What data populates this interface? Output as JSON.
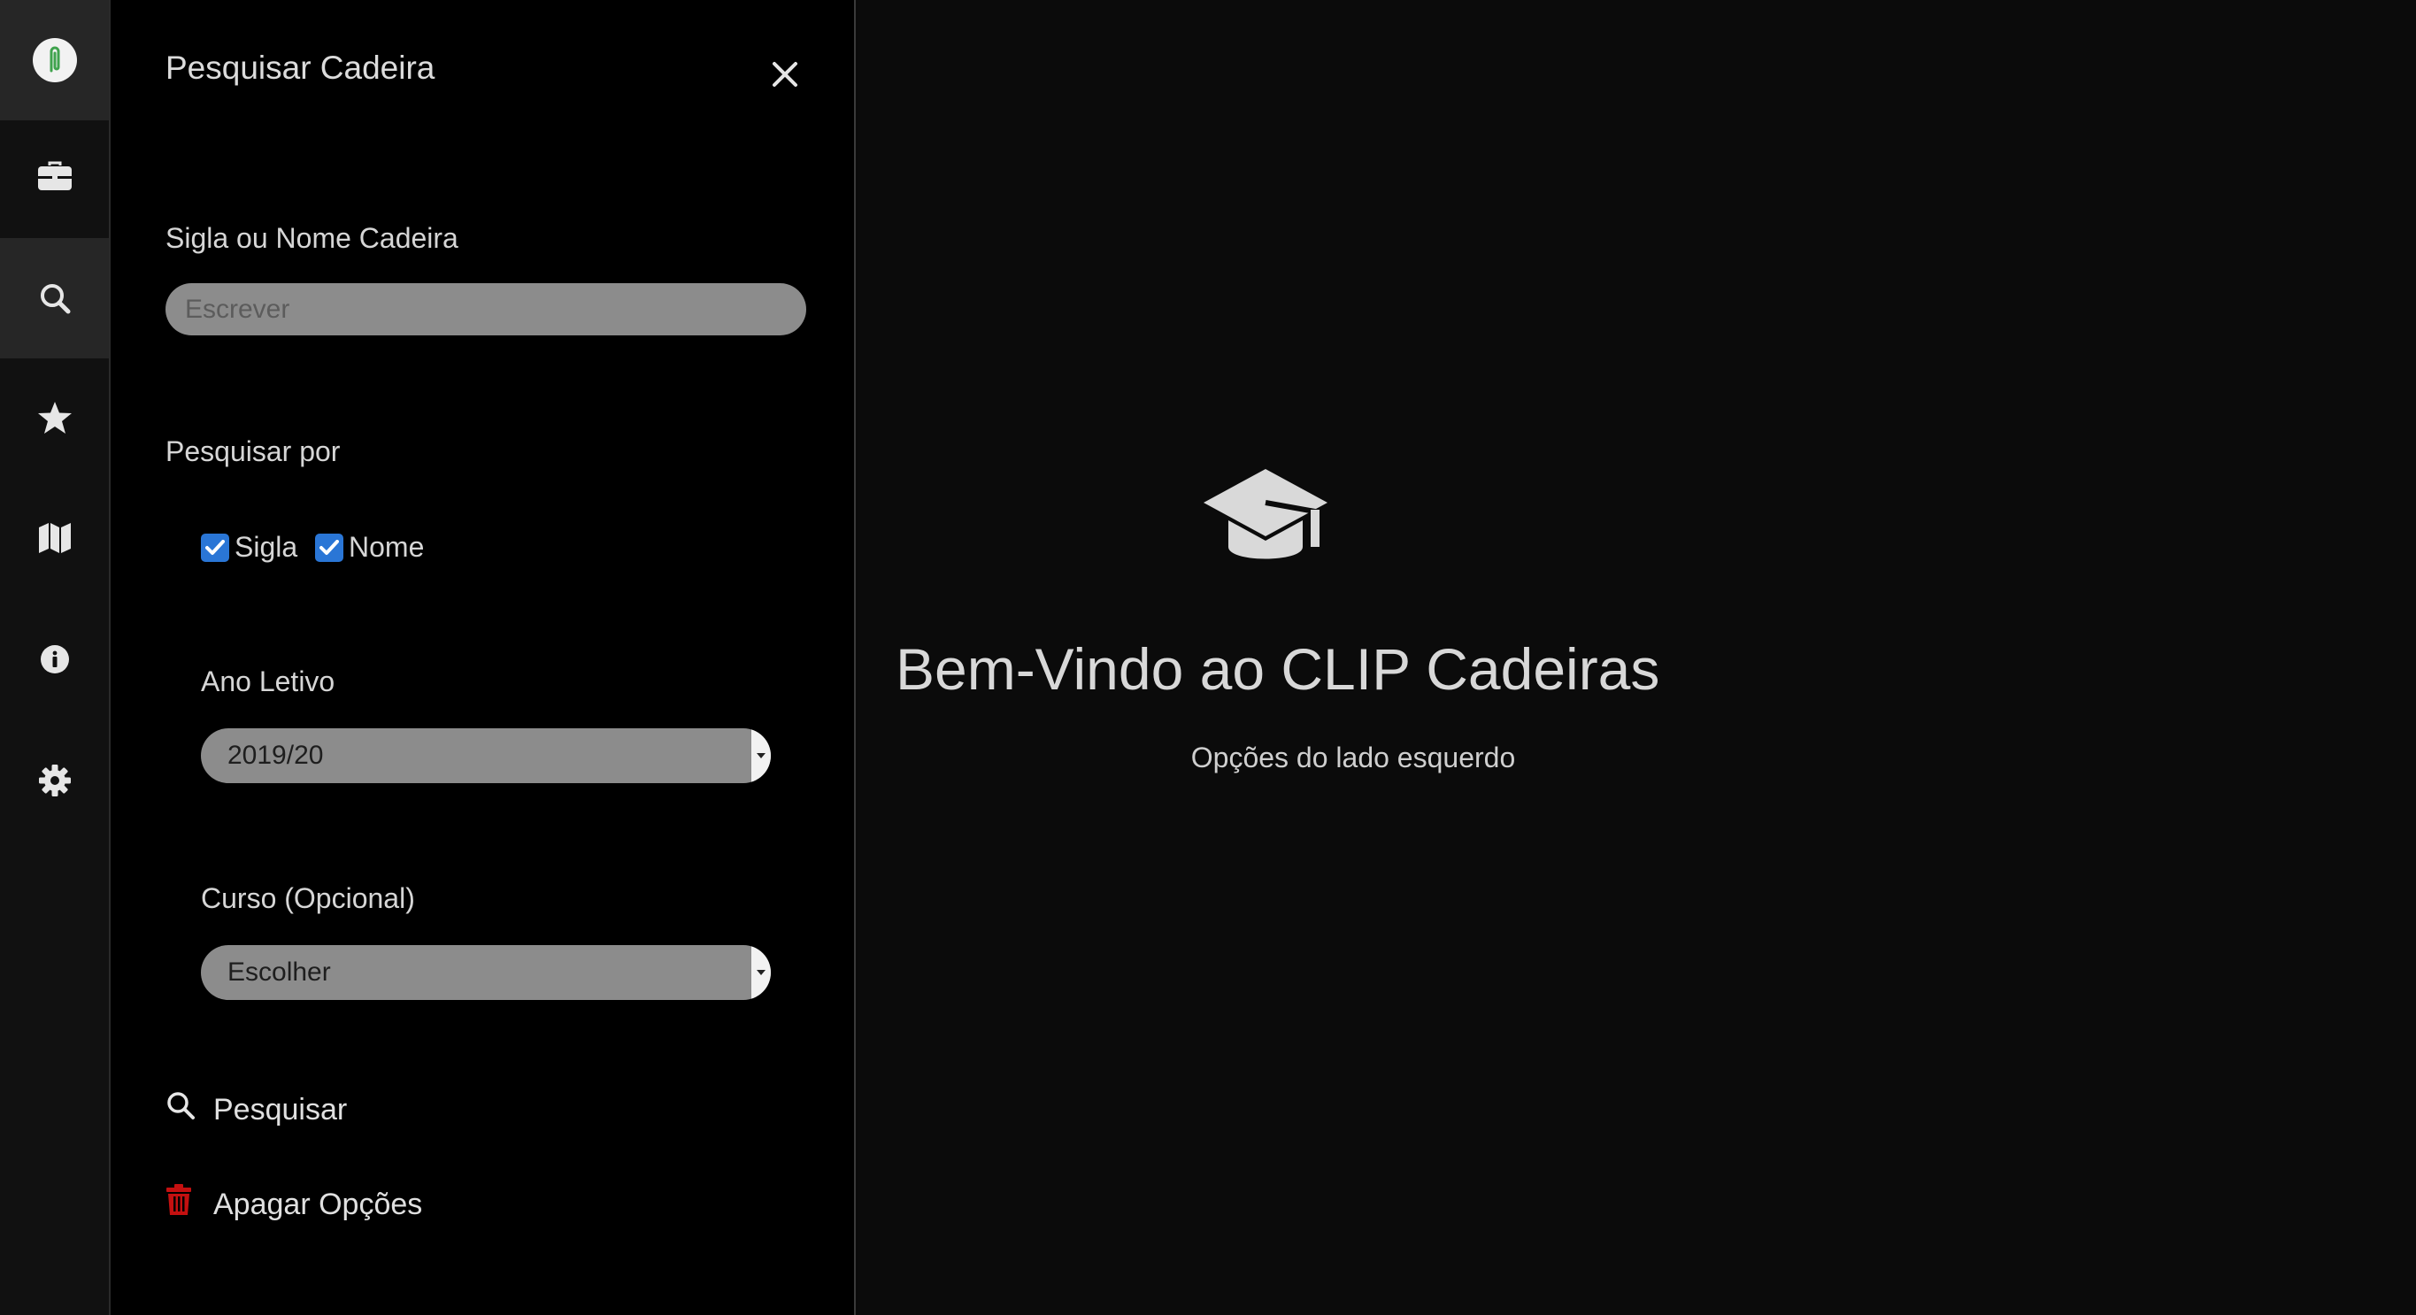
{
  "rail": {
    "items": [
      {
        "icon": "clip-logo-icon",
        "active": true
      },
      {
        "icon": "briefcase-icon",
        "active": false
      },
      {
        "icon": "search-icon",
        "active": true
      },
      {
        "icon": "star-icon",
        "active": false
      },
      {
        "icon": "map-icon",
        "active": false
      },
      {
        "icon": "info-icon",
        "active": false
      },
      {
        "icon": "gear-icon",
        "active": false
      }
    ]
  },
  "panel": {
    "title": "Pesquisar Cadeira",
    "name_field": {
      "label": "Sigla ou Nome Cadeira",
      "value": "",
      "placeholder": "Escrever"
    },
    "search_by": {
      "label": "Pesquisar por",
      "options": [
        {
          "label": "Sigla",
          "checked": true
        },
        {
          "label": "Nome",
          "checked": true
        }
      ]
    },
    "year": {
      "label": "Ano Letivo",
      "selected": "2019/20"
    },
    "course": {
      "label": "Curso (Opcional)",
      "selected": "Escolher"
    },
    "actions": {
      "search_label": "Pesquisar",
      "clear_label": "Apagar Opções"
    }
  },
  "main": {
    "title": "Bem-Vindo ao CLIP Cadeiras",
    "subtitle": "Opções do lado esquerdo"
  },
  "colors": {
    "checkbox": "#2a76d6",
    "trash": "#c41010",
    "accent_logo": "#3fa34d"
  }
}
